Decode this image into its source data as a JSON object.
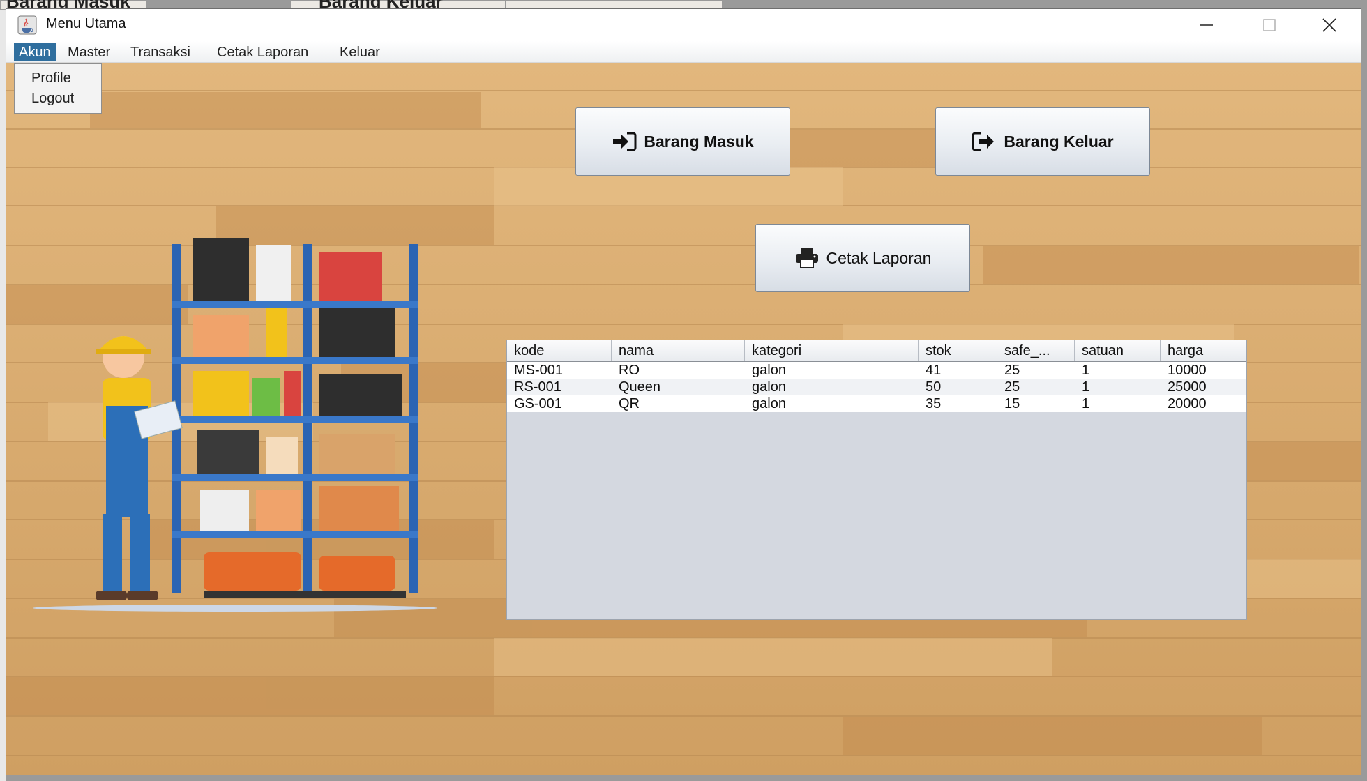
{
  "window": {
    "title": "Menu Utama"
  },
  "background_windows": [
    "Barang Masuk",
    "Barang Keluar"
  ],
  "menubar": {
    "items": [
      "Akun",
      "Master",
      "Transaksi",
      "Cetak Laporan",
      "Keluar"
    ],
    "active": "Akun"
  },
  "dropdown": {
    "items": [
      "Profile",
      "Logout"
    ]
  },
  "buttons": {
    "barang_masuk": "Barang Masuk",
    "barang_keluar": "Barang Keluar",
    "cetak_laporan": "Cetak Laporan"
  },
  "table": {
    "columns": [
      "kode",
      "nama",
      "kategori",
      "stok",
      "safe_...",
      "satuan",
      "harga"
    ],
    "rows": [
      [
        "MS-001",
        "RO",
        "galon",
        "41",
        "25",
        "1",
        "10000"
      ],
      [
        "RS-001",
        "Queen",
        "galon",
        "50",
        "25",
        "1",
        "25000"
      ],
      [
        "GS-001",
        "QR",
        "galon",
        "35",
        "15",
        "1",
        "20000"
      ]
    ]
  },
  "colors": {
    "menu_active": "#2f6e9e",
    "floor": "#d6a86b",
    "table_empty": "#d4d8e0"
  }
}
